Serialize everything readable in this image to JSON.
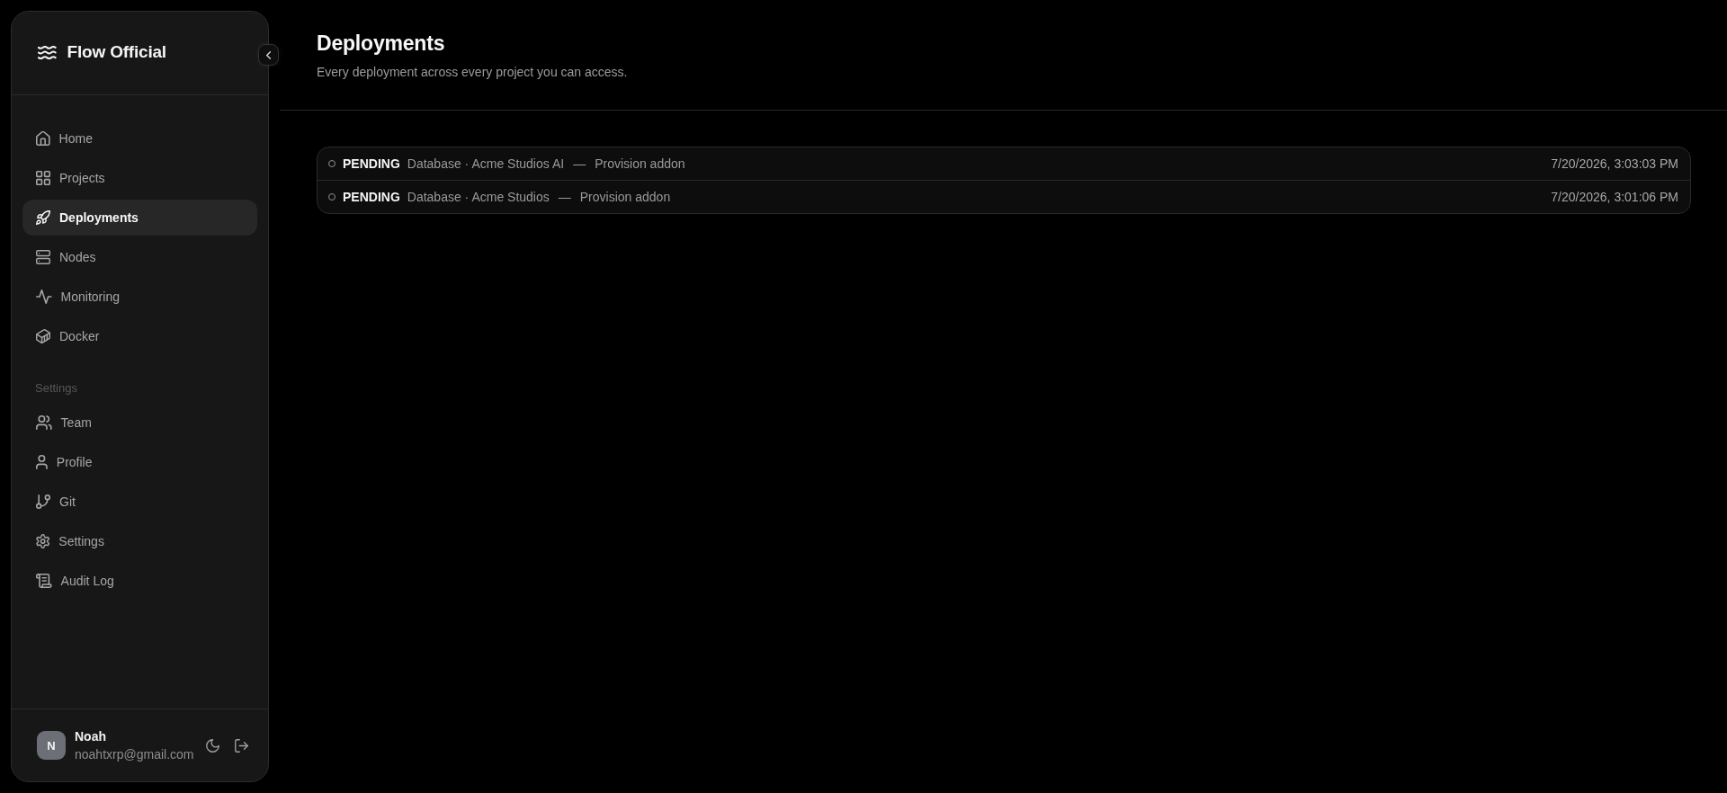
{
  "sidebar": {
    "brand": "Flow Official",
    "sections": [
      {
        "items": [
          {
            "label": "Home",
            "selected": false
          },
          {
            "label": "Projects",
            "selected": false
          },
          {
            "label": "Deployments",
            "selected": true
          },
          {
            "label": "Nodes",
            "selected": false
          },
          {
            "label": "Monitoring",
            "selected": false
          },
          {
            "label": "Docker",
            "selected": false
          }
        ]
      },
      {
        "heading": "Settings",
        "items": [
          {
            "label": "Team",
            "selected": false
          },
          {
            "label": "Profile",
            "selected": false
          },
          {
            "label": "Git",
            "selected": false
          },
          {
            "label": "Settings",
            "selected": false
          },
          {
            "label": "Audit Log",
            "selected": false
          }
        ]
      }
    ],
    "user": {
      "initial": "N",
      "name": "Noah",
      "email": "noahtxrp@gmail.com"
    }
  },
  "page": {
    "title": "Deployments",
    "subtitle": "Every deployment across every project you can access."
  },
  "deployments": [
    {
      "status": "PENDING",
      "target": "Database · Acme Studios AI",
      "separator": "—",
      "action": "Provision addon",
      "time": "7/20/2026, 3:03:03 PM"
    },
    {
      "status": "PENDING",
      "target": "Database · Acme Studios",
      "separator": "—",
      "action": "Provision addon",
      "time": "7/20/2026, 3:01:06 PM"
    }
  ]
}
